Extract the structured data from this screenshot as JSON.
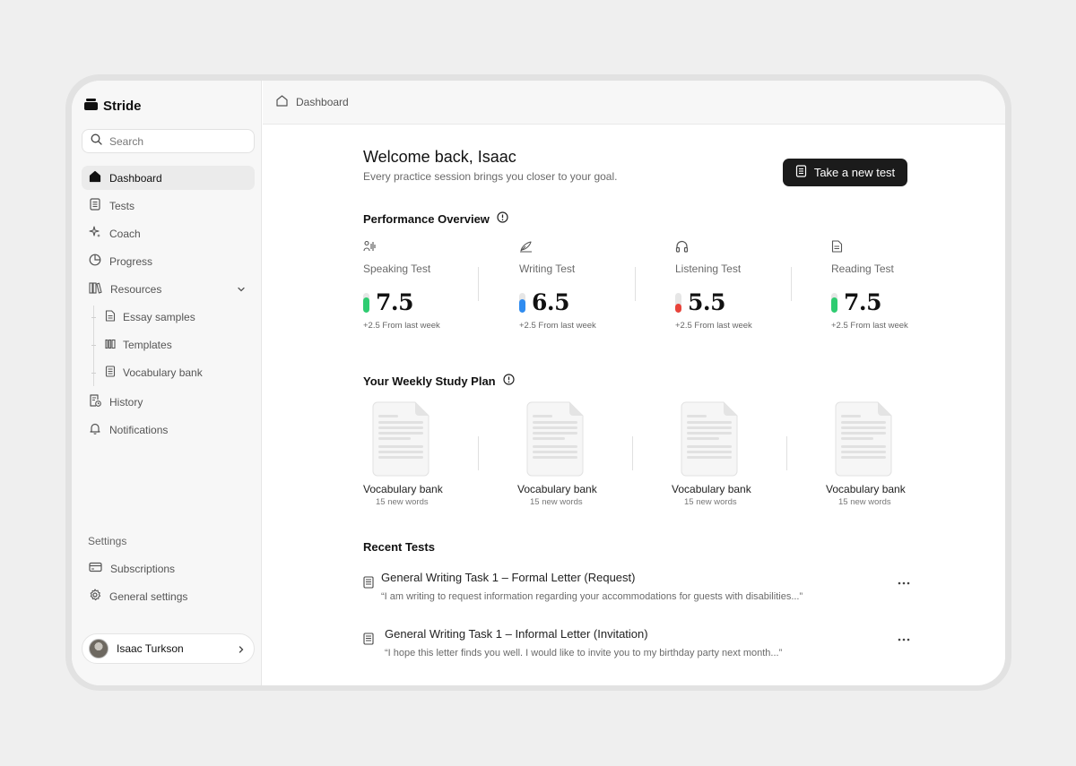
{
  "app": {
    "name": "Stride"
  },
  "search": {
    "placeholder": "Search"
  },
  "sidebar": {
    "items": [
      {
        "label": "Dashboard",
        "icon": "home-icon"
      },
      {
        "label": "Tests",
        "icon": "book-icon"
      },
      {
        "label": "Coach",
        "icon": "sparkles-icon"
      },
      {
        "label": "Progress",
        "icon": "pie-chart-icon"
      },
      {
        "label": "Resources",
        "icon": "library-icon"
      },
      {
        "label": "History",
        "icon": "history-icon"
      },
      {
        "label": "Notifications",
        "icon": "bell-icon"
      }
    ],
    "resources_sub": [
      {
        "label": "Essay samples",
        "icon": "document-icon"
      },
      {
        "label": "Templates",
        "icon": "templates-icon"
      },
      {
        "label": "Vocabulary bank",
        "icon": "notebook-icon"
      }
    ],
    "settings_label": "Settings",
    "settings_items": [
      {
        "label": "Subscriptions",
        "icon": "credit-card-icon"
      },
      {
        "label": "General settings",
        "icon": "gear-icon"
      }
    ],
    "user": {
      "name": "Isaac Turkson"
    }
  },
  "breadcrumb": {
    "label": "Dashboard"
  },
  "welcome": {
    "title": "Welcome back, Isaac",
    "subtitle": "Every practice session brings you closer to your goal.",
    "cta": "Take a new test"
  },
  "performance": {
    "title": "Performance Overview",
    "metrics": [
      {
        "label": "Speaking Test",
        "score": "7.5",
        "delta": "+2.5 From last week",
        "icon": "speaking-icon",
        "color": "#2ecc71",
        "level": 0.75
      },
      {
        "label": "Writing Test",
        "score": "6.5",
        "delta": "+2.5 From last week",
        "icon": "writing-icon",
        "color": "#2f8cf0",
        "level": 0.65
      },
      {
        "label": "Listening Test",
        "score": "5.5",
        "delta": "+2.5 From last week",
        "icon": "headphones-icon",
        "color": "#e8433a",
        "level": 0.45
      },
      {
        "label": "Reading Test",
        "score": "7.5",
        "delta": "+2.5 From last week",
        "icon": "reading-icon",
        "color": "#2ecc71",
        "level": 0.75
      }
    ]
  },
  "study_plan": {
    "title": "Your Weekly Study Plan",
    "items": [
      {
        "title": "Vocabulary bank",
        "subtitle": "15 new words"
      },
      {
        "title": "Vocabulary bank",
        "subtitle": "15 new words"
      },
      {
        "title": "Vocabulary bank",
        "subtitle": "15 new words"
      },
      {
        "title": "Vocabulary bank",
        "subtitle": "15 new words"
      }
    ]
  },
  "recent_tests": {
    "title": "Recent Tests",
    "items": [
      {
        "title": "General Writing Task 1 – Formal Letter (Request)",
        "excerpt": "“I am writing to request information regarding your accommodations for guests with disabilities...”"
      },
      {
        "title": "General Writing Task 1 – Informal Letter (Invitation)",
        "excerpt": "“I hope this letter finds you well. I would like to invite you to my birthday party next month...”"
      }
    ]
  }
}
